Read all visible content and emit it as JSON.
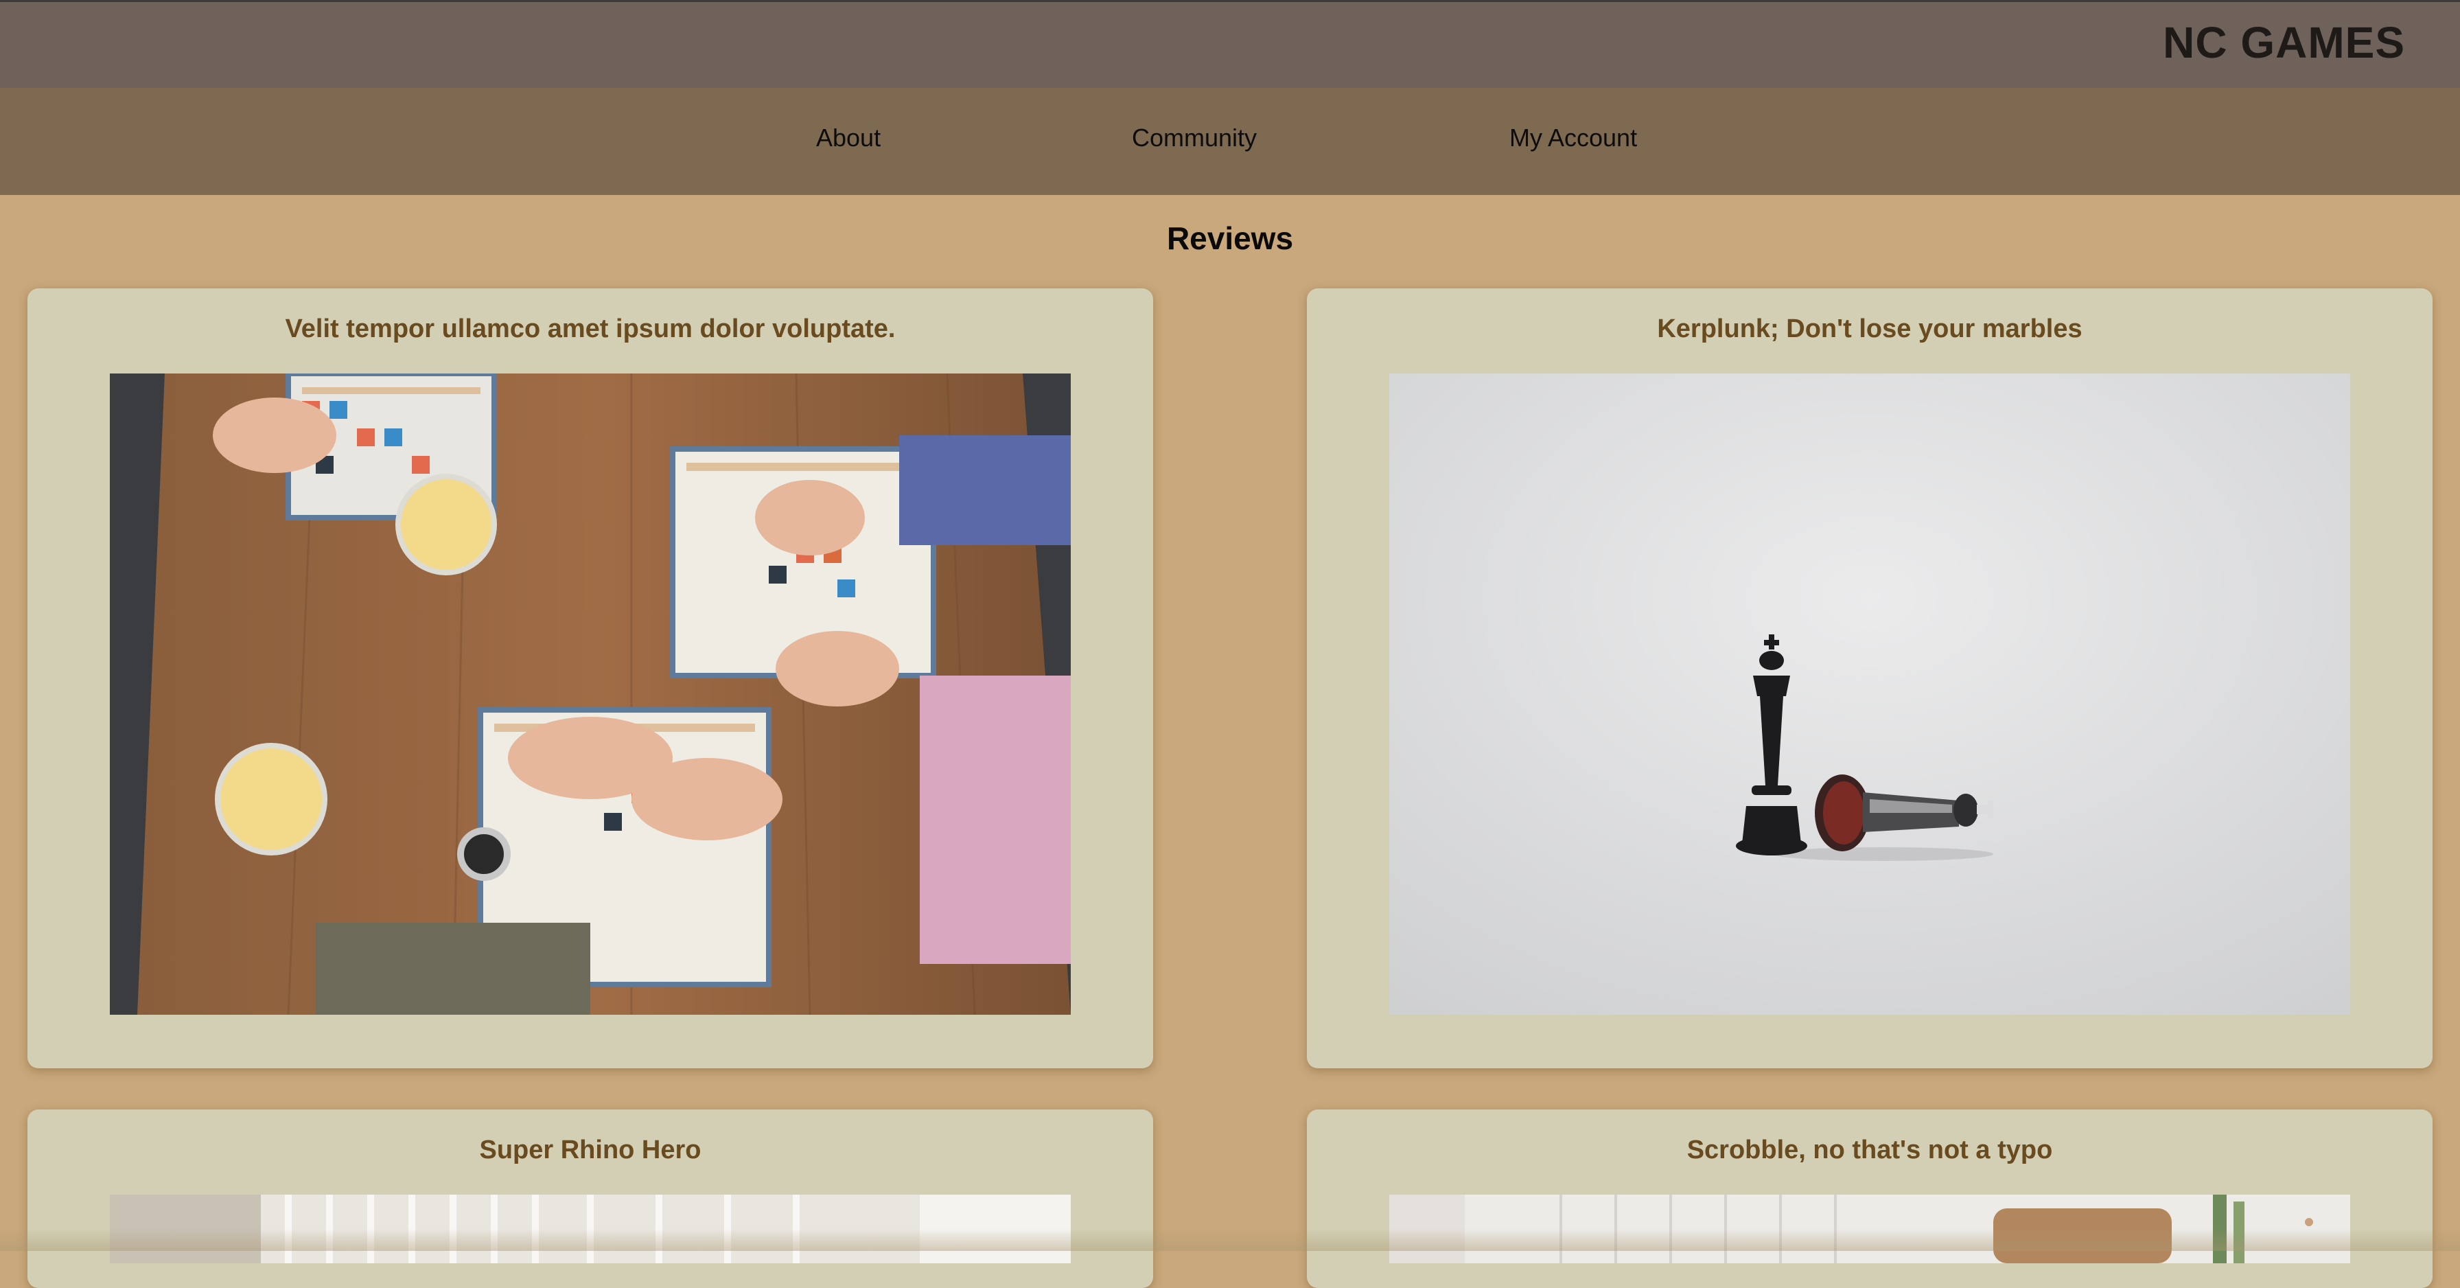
{
  "header": {
    "brand": "NC GAMES"
  },
  "nav": {
    "items": [
      {
        "label": "About"
      },
      {
        "label": "Community"
      },
      {
        "label": "My Account"
      }
    ]
  },
  "main": {
    "heading": "Reviews",
    "reviews": [
      {
        "title": "Velit tempor ullamco amet ipsum dolor voluptate.",
        "image": "board-game-players-photo"
      },
      {
        "title": "Kerplunk; Don't lose your marbles",
        "image": "chess-kings-photo"
      },
      {
        "title": "Super Rhino Hero",
        "image": "curtained-room-photo"
      },
      {
        "title": "Scrobble, no that's not a typo",
        "image": "living-room-photo"
      }
    ]
  },
  "colors": {
    "topbar": "#6e625a",
    "navbar": "#7d6a51",
    "page_background": "#c9a87b",
    "card_background": "#d2cfb4",
    "card_title": "#6a4a1f"
  }
}
